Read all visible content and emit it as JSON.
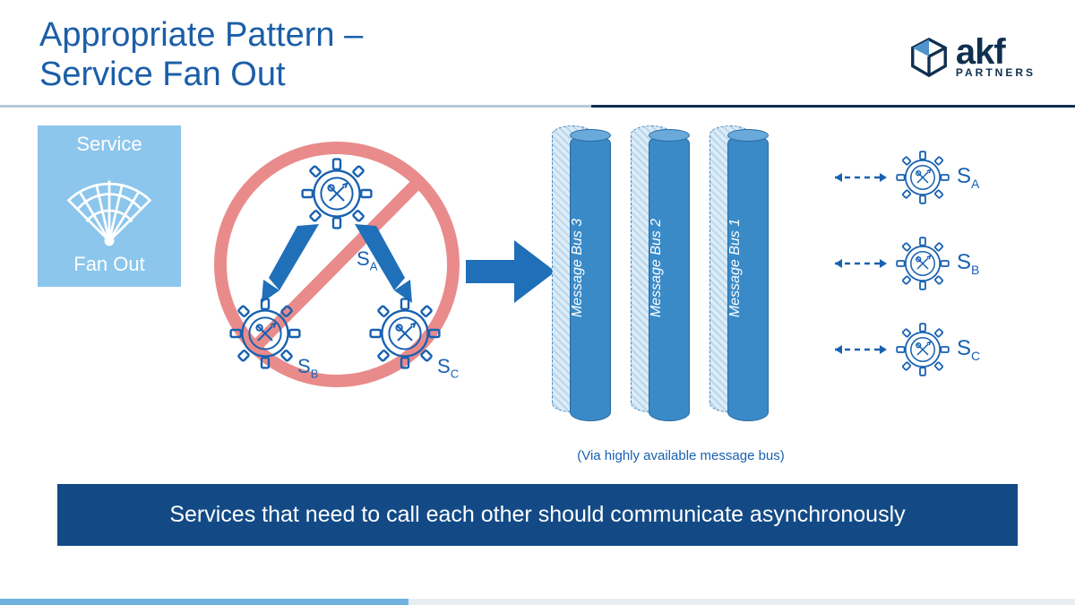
{
  "header": {
    "title_line1": "Appropriate Pattern –",
    "title_line2": "Service Fan Out"
  },
  "logo": {
    "brand": "akf",
    "tagline": "PARTNERS"
  },
  "fan_card": {
    "top": "Service",
    "bottom": "Fan Out"
  },
  "anti": {
    "services": {
      "a": "S",
      "a_sub": "A",
      "b": "S",
      "b_sub": "B",
      "c": "S",
      "c_sub": "C"
    }
  },
  "buses": {
    "labels": [
      "Message Bus 3",
      "Message Bus 2",
      "Message Bus 1"
    ],
    "caption": "(Via highly available message bus)"
  },
  "right_services": [
    {
      "label": "S",
      "sub": "A"
    },
    {
      "label": "S",
      "sub": "B"
    },
    {
      "label": "S",
      "sub": "C"
    }
  ],
  "banner": "Services that need to call each other should communicate asynchronously",
  "colors": {
    "primary": "#1861b1",
    "accent": "#3a8ac8",
    "dark": "#134a86"
  }
}
